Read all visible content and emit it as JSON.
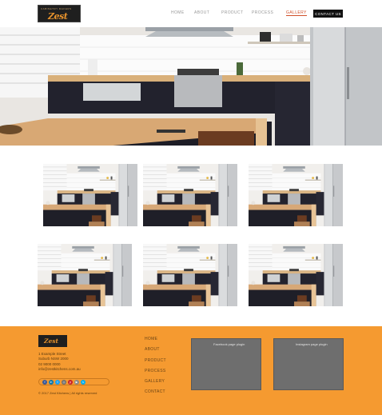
{
  "header": {
    "logo_tagline": "CABINETRY MAKERS",
    "logo_script": "Zest",
    "nav": [
      "HOME",
      "ABOUT",
      "PRODUCT",
      "PROCESS",
      "GALLERY"
    ],
    "active_nav": "GALLERY",
    "contact_label": "CONTACT US"
  },
  "footer": {
    "logo_script": "Zest",
    "address_lines": [
      "1 Example Street",
      "Suburb NSW 2000",
      "02 9000 0000",
      "info@zestkitchens.com.au"
    ],
    "social_icons": [
      "facebook-icon",
      "linkedin-icon",
      "twitter-icon",
      "instagram-icon",
      "pinterest-icon",
      "youtube-icon",
      "skype-icon"
    ],
    "copyright": "© 2017 Zest Kitchens | All rights reserved",
    "links": [
      "HOME",
      "ABOUT",
      "PRODUCT",
      "PROCESS",
      "GALLERY",
      "CONTACT"
    ],
    "box1_label": "Facebook page plugin",
    "box2_label": "Instagram page plugin"
  },
  "colors": {
    "accent": "#d0502a",
    "footer_bg": "#f59a30",
    "plugin_box": "#6e6e6e"
  }
}
